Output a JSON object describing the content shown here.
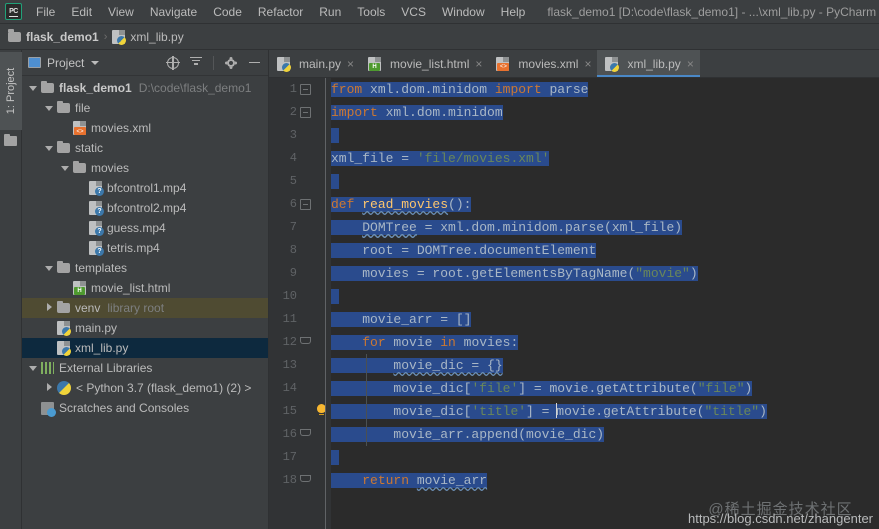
{
  "menubar": {
    "logo": "PC",
    "items": [
      "File",
      "Edit",
      "View",
      "Navigate",
      "Code",
      "Refactor",
      "Run",
      "Tools",
      "VCS",
      "Window",
      "Help"
    ],
    "window_title": "flask_demo1 [D:\\code\\flask_demo1] - ...\\xml_lib.py - PyCharm"
  },
  "breadcrumb": {
    "project": "flask_demo1",
    "separator": "›",
    "file": "xml_lib.py"
  },
  "left_strip": {
    "project_tab": "1: Project"
  },
  "project_panel": {
    "title": "Project",
    "tools": [
      "locate-icon",
      "collapse-all-icon",
      "gear-icon",
      "minimize-icon"
    ],
    "tree": [
      {
        "label": "flask_demo1",
        "detail": "D:\\code\\flask_demo1",
        "icon": "folder-icon",
        "indent": 0,
        "arrow": "open",
        "bold": true,
        "state": "normal"
      },
      {
        "label": "file",
        "detail": "",
        "icon": "folder-icon",
        "indent": 1,
        "arrow": "open",
        "bold": false,
        "state": "normal"
      },
      {
        "label": "movies.xml",
        "detail": "",
        "icon": "xml-file-icon",
        "indent": 2,
        "arrow": "none",
        "bold": false,
        "state": "normal"
      },
      {
        "label": "static",
        "detail": "",
        "icon": "folder-icon",
        "indent": 1,
        "arrow": "open",
        "bold": false,
        "state": "normal"
      },
      {
        "label": "movies",
        "detail": "",
        "icon": "folder-icon",
        "indent": 2,
        "arrow": "open",
        "bold": false,
        "state": "normal"
      },
      {
        "label": "bfcontrol1.mp4",
        "detail": "",
        "icon": "media-file-icon",
        "indent": 3,
        "arrow": "none",
        "bold": false,
        "state": "normal"
      },
      {
        "label": "bfcontrol2.mp4",
        "detail": "",
        "icon": "media-file-icon",
        "indent": 3,
        "arrow": "none",
        "bold": false,
        "state": "normal"
      },
      {
        "label": "guess.mp4",
        "detail": "",
        "icon": "media-file-icon",
        "indent": 3,
        "arrow": "none",
        "bold": false,
        "state": "normal"
      },
      {
        "label": "tetris.mp4",
        "detail": "",
        "icon": "media-file-icon",
        "indent": 3,
        "arrow": "none",
        "bold": false,
        "state": "normal"
      },
      {
        "label": "templates",
        "detail": "",
        "icon": "folder-icon",
        "indent": 1,
        "arrow": "open",
        "bold": false,
        "state": "normal"
      },
      {
        "label": "movie_list.html",
        "detail": "",
        "icon": "html-file-icon",
        "indent": 2,
        "arrow": "none",
        "bold": false,
        "state": "normal"
      },
      {
        "label": "venv",
        "detail": "library root",
        "icon": "folder-icon",
        "indent": 1,
        "arrow": "closed",
        "bold": false,
        "state": "library"
      },
      {
        "label": "main.py",
        "detail": "",
        "icon": "python-file-icon",
        "indent": 1,
        "arrow": "none",
        "bold": false,
        "state": "normal"
      },
      {
        "label": "xml_lib.py",
        "detail": "",
        "icon": "python-file-icon",
        "indent": 1,
        "arrow": "none",
        "bold": false,
        "state": "selected"
      },
      {
        "label": "External Libraries",
        "detail": "",
        "icon": "libraries-icon",
        "indent": 0,
        "arrow": "open",
        "bold": false,
        "state": "normal"
      },
      {
        "label": "< Python 3.7 (flask_demo1) (2) >",
        "detail": "",
        "icon": "python-env-icon",
        "indent": 1,
        "arrow": "closed",
        "bold": false,
        "state": "normal"
      },
      {
        "label": "Scratches and Consoles",
        "detail": "",
        "icon": "scratches-icon",
        "indent": 0,
        "arrow": "none",
        "bold": false,
        "state": "normal"
      }
    ]
  },
  "editor": {
    "tabs": [
      {
        "label": "main.py",
        "icon": "python-file-icon",
        "active": false,
        "close": "×"
      },
      {
        "label": "movie_list.html",
        "icon": "html-file-icon",
        "active": false,
        "close": "×"
      },
      {
        "label": "movies.xml",
        "icon": "xml-file-icon",
        "active": false,
        "close": "×"
      },
      {
        "label": "xml_lib.py",
        "icon": "python-file-icon",
        "active": true,
        "close": "×"
      }
    ],
    "line_numbers": [
      "1",
      "2",
      "3",
      "4",
      "5",
      "6",
      "7",
      "8",
      "9",
      "10",
      "11",
      "12",
      "13",
      "14",
      "15",
      "16",
      "17",
      "18"
    ],
    "code_lines": [
      "from xml.dom.minidom import parse",
      "import xml.dom.minidom",
      "",
      "xml_file = 'file/movies.xml'",
      "",
      "def read_movies():",
      "    DOMTree = xml.dom.minidom.parse(xml_file)",
      "    root = DOMTree.documentElement",
      "    movies = root.getElementsByTagName(\"movie\")",
      "",
      "    movie_arr = []",
      "    for movie in movies:",
      "        movie_dic = {}",
      "        movie_dic['file'] = movie.getAttribute(\"file\")",
      "        movie_dic['title'] = movie.getAttribute(\"title\")",
      "        movie_arr.append(movie_dic)",
      "",
      "    return movie_arr"
    ],
    "gutter_markers": {
      "fold_lines": [
        1,
        2,
        6,
        12,
        16,
        18
      ],
      "bulb_line": 15
    },
    "colors": {
      "selection": "#2A4B8D",
      "keyword": "#CC7832",
      "string": "#6A8759",
      "function": "#FFC66D",
      "text": "#A9B7C6",
      "background": "#2B2B2B",
      "gutter": "#313335",
      "accent": "#4A88C7"
    }
  },
  "watermark": {
    "cn": "@稀土掘金技术社区",
    "url": "https://blog.csdn.net/zhangenter"
  }
}
